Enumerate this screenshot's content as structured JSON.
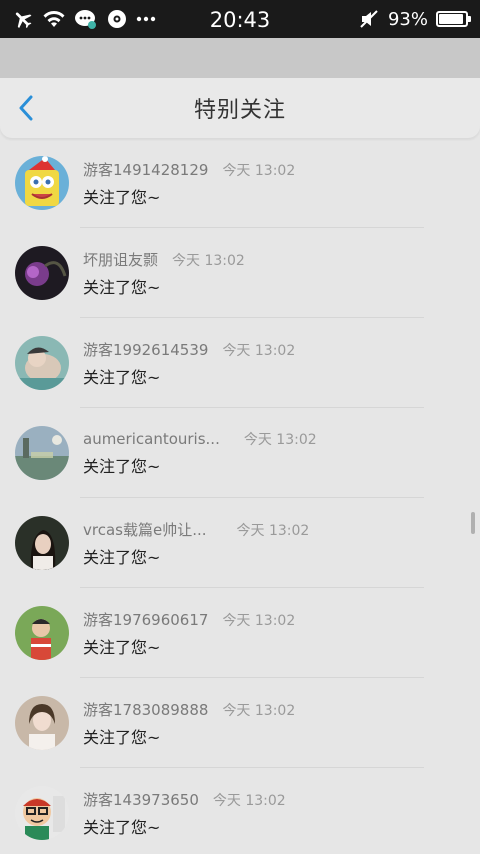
{
  "status_bar": {
    "time": "20:43",
    "battery_text": "93%",
    "battery_level": 0.93,
    "left_icons": [
      "airplane-icon",
      "wifi-icon",
      "chat-bubble-icon",
      "qq-icon",
      "more-dots-icon"
    ],
    "right_icons": [
      "mute-icon",
      "battery-icon"
    ]
  },
  "header": {
    "title": "特别关注",
    "back_icon": "chevron-left-icon",
    "accent": "#2a8fd8"
  },
  "items": [
    {
      "name": "游客1491428129",
      "time": "今天 13:02",
      "message": "关注了您~",
      "avatar": "spongebob"
    },
    {
      "name": "坏朋诅友颢",
      "time": "今天 13:02",
      "message": "关注了您~",
      "avatar": "dark-purple"
    },
    {
      "name": "游客1992614539",
      "time": "今天 13:02",
      "message": "关注了您~",
      "avatar": "teal-person"
    },
    {
      "name": "aumericantouris...",
      "time": "今天 13:02",
      "message": "关注了您~",
      "avatar": "landscape"
    },
    {
      "name": "vrcas载篇e帅让...",
      "time": "今天 13:02",
      "message": "关注了您~",
      "avatar": "girl-dark"
    },
    {
      "name": "游客1976960617",
      "time": "今天 13:02",
      "message": "关注了您~",
      "avatar": "child-green"
    },
    {
      "name": "游客1783089888",
      "time": "今天 13:02",
      "message": "关注了您~",
      "avatar": "woman-light"
    },
    {
      "name": "游客143973650",
      "time": "今天 13:02",
      "message": "关注了您~",
      "avatar": "cartoon-glasses"
    }
  ]
}
